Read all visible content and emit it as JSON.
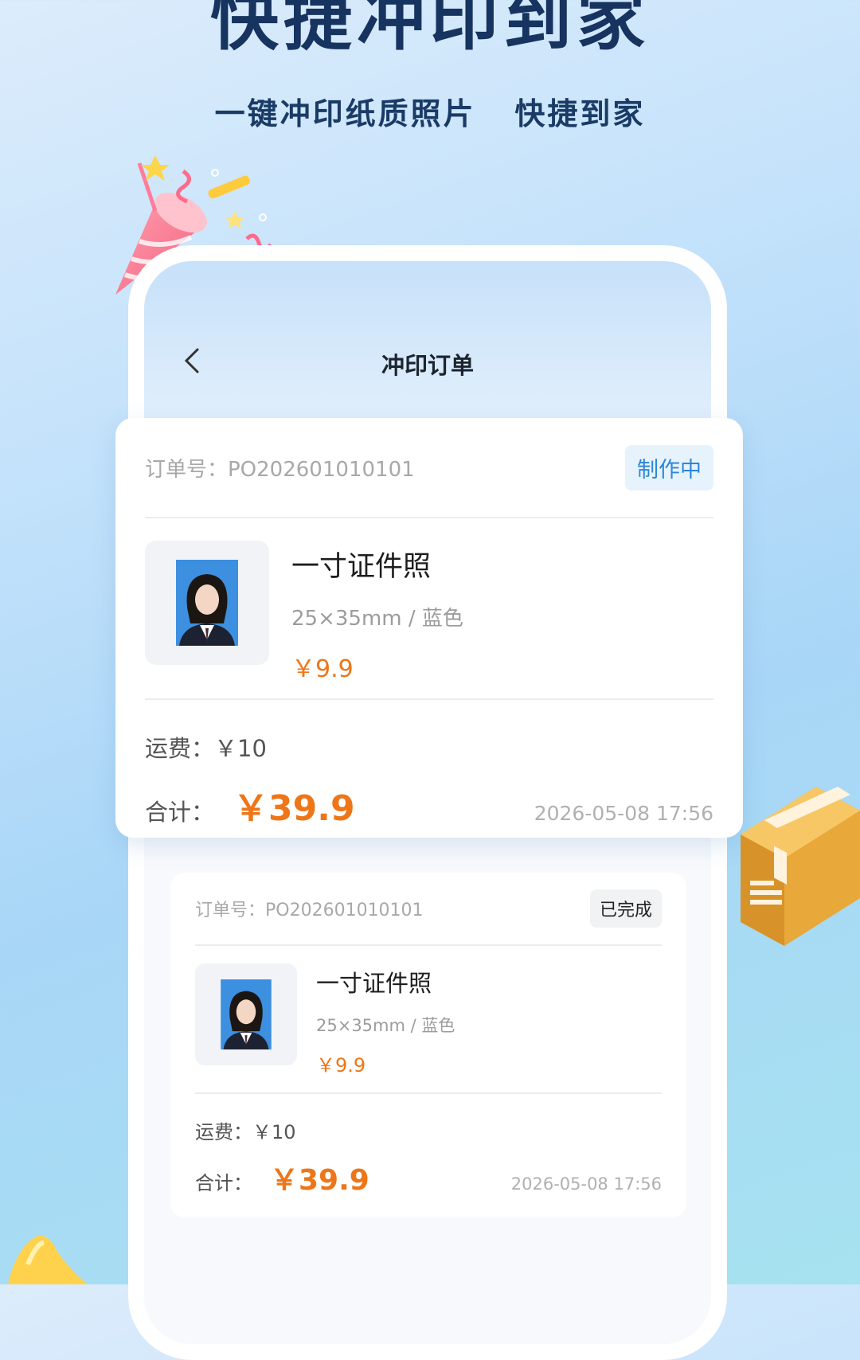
{
  "headline": "快捷冲印到家",
  "subline": "一键冲印纸质照片   快捷到家",
  "nav": {
    "title": "冲印订单"
  },
  "orders": [
    {
      "order_no": "订单号：PO202601010101",
      "status": "制作中",
      "product_name": "一寸证件照",
      "spec": "25×35mm / 蓝色",
      "price": "￥9.9",
      "shipping": "运费：￥10",
      "total_label": "合计：",
      "total": "￥39.9",
      "date": "2026-05-08 17:56"
    },
    {
      "order_no": "订单号：PO202601010101",
      "status": "已完成",
      "product_name": "一寸证件照",
      "spec": "25×35mm / 蓝色",
      "price": "￥9.9",
      "shipping": "运费：￥10",
      "total_label": "合计：",
      "total": "￥39.9",
      "date": "2026-05-08 17:56"
    }
  ],
  "colors": {
    "accent_orange": "#ee7618",
    "status_blue": "#2d86d8",
    "headline": "#17335f",
    "photo_bg": "#3d8fe0"
  },
  "icons": [
    "back-chevron-icon",
    "party-popper-icon",
    "package-box-icon",
    "id-photo-icon"
  ]
}
